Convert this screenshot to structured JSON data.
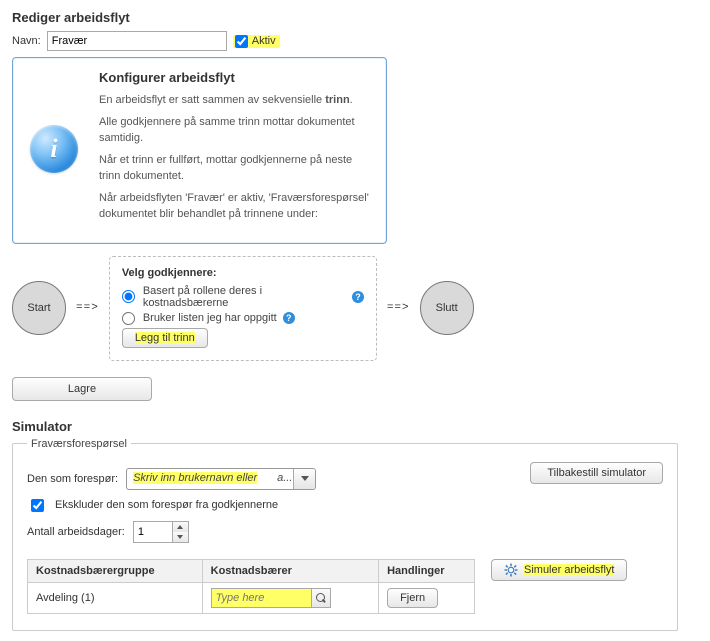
{
  "page": {
    "title": "Rediger arbeidsflyt",
    "name_label": "Navn:",
    "name_value": "Fravær",
    "active_label": "Aktiv"
  },
  "info": {
    "title": "Konfigurer arbeidsflyt",
    "lines": [
      {
        "pre": "En arbeidsflyt er satt sammen av sekvensielle ",
        "bold": "trinn",
        "post": "."
      },
      {
        "pre": "Alle godkjennere på samme trinn mottar dokumentet samtidig.",
        "bold": "",
        "post": ""
      },
      {
        "pre": "Når et trinn er fullført, mottar godkjennerne på neste trinn dokumentet.",
        "bold": "",
        "post": ""
      },
      {
        "pre": "Når arbeidsflyten 'Fravær' er aktiv, 'Fraværsforespørsel' dokumentet blir behandlet på trinnene under:",
        "bold": "",
        "post": ""
      }
    ]
  },
  "flow": {
    "start": "Start",
    "end": "Slutt",
    "arrow": "==>",
    "step_title": "Velg godkjennere:",
    "opt_roles": "Basert på rollene deres i kostnadsbærerne",
    "opt_list": "Bruker listen jeg har oppgitt",
    "add_step": "Legg til trinn"
  },
  "buttons": {
    "save": "Lagre",
    "reset_sim": "Tilbakestill simulator",
    "simulate": "Simuler arbeidsflyt",
    "remove": "Fjern"
  },
  "sim": {
    "title": "Simulator",
    "legend": "Fraværsforespørsel",
    "requester_label": "Den som forespør:",
    "combo_placeholder": "Skriv inn brukernavn eller",
    "combo_suffix": "a...",
    "exclude_label": "Ekskluder den som forespør fra godkjennerne",
    "days_label": "Antall arbeidsdager:",
    "days_value": "1",
    "col_group": "Kostnadsbærergruppe",
    "col_carrier": "Kostnadsbærer",
    "col_actions": "Handlinger",
    "row_group": "Avdeling (1)",
    "type_here": "Type here"
  }
}
